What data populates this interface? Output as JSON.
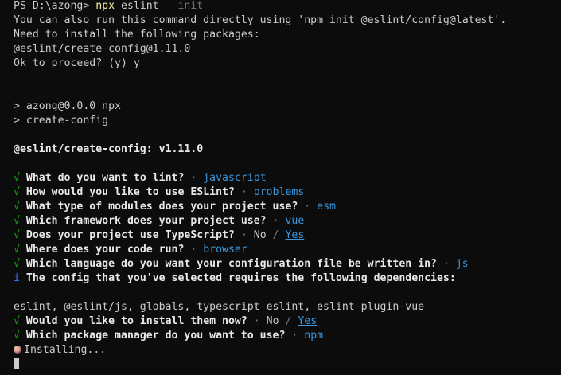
{
  "terminal": {
    "prompt": "PS D:\\azong> ",
    "cmd_npx": "npx",
    "cmd_eslint": "eslint",
    "cmd_flag": "--init",
    "line_run_directly": "You can also run this command directly using 'npm init @eslint/config@latest'.",
    "line_need_install": "Need to install the following packages:",
    "line_pkg": "@eslint/create-config@1.11.0",
    "line_ok": "Ok to proceed? (y) y",
    "line_azong": "> azong@0.0.0 npx",
    "line_create": "> create-config",
    "line_version": "@eslint/create-config: v1.11.0",
    "check_mark": "√",
    "info_mark": "i",
    "sep": " · ",
    "q1": "What do you want to lint?",
    "a1": "javascript",
    "q2": "How would you like to use ESLint?",
    "a2": "problems",
    "q3": "What type of modules does your project use?",
    "a3": "esm",
    "q4": "Which framework does your project use?",
    "a4": "vue",
    "q5": "Does your project use TypeScript?",
    "a5_no": "No",
    "a5_slash": " / ",
    "a5_yes": "Yes",
    "q6": "Where does your code run?",
    "a6": "browser",
    "q7": "Which language do you want your configuration file be written in?",
    "a7": "js",
    "info_text": "The config that you've selected requires the following dependencies:",
    "deps": "eslint, @eslint/js, globals, typescript-eslint, eslint-plugin-vue",
    "q8": "Would you like to install them now?",
    "a8_no": "No",
    "a8_slash": " / ",
    "a8_yes": "Yes",
    "q9": "Which package manager do you want to use?",
    "a9": "npm",
    "installing": "Installing..."
  }
}
